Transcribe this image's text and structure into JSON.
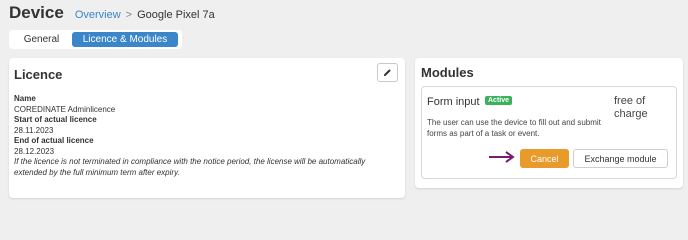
{
  "header": {
    "title": "Device",
    "breadcrumb": {
      "link": "Overview",
      "separator": ">",
      "current": "Google Pixel 7a"
    }
  },
  "tabs": [
    {
      "label": "General",
      "active": false
    },
    {
      "label": "Licence & Modules",
      "active": true
    }
  ],
  "licence": {
    "title": "Licence",
    "edit_icon": "pencil-icon",
    "name_label": "Name",
    "name_value": "COREDINATE Adminlicence",
    "start_label": "Start of actual licence",
    "start_value": "28.11.2023",
    "end_label": "End of actual licence",
    "end_value": "28.12.2023",
    "note": "If the licence is not terminated in compliance with the notice period, the license will be automatically extended by the full minimum term after expiry."
  },
  "modules": {
    "title": "Modules",
    "items": [
      {
        "name": "Form input",
        "status": "Active",
        "price": "free of charge",
        "description": "The user can use the device to fill out and submit forms as part of a task or event.",
        "cancel_label": "Cancel",
        "exchange_label": "Exchange module"
      }
    ]
  },
  "colors": {
    "primary": "#3a86c8",
    "active_badge": "#3cb15b",
    "cancel": "#e89a2b",
    "arrow": "#7b1b6e",
    "background": "#efefef"
  }
}
